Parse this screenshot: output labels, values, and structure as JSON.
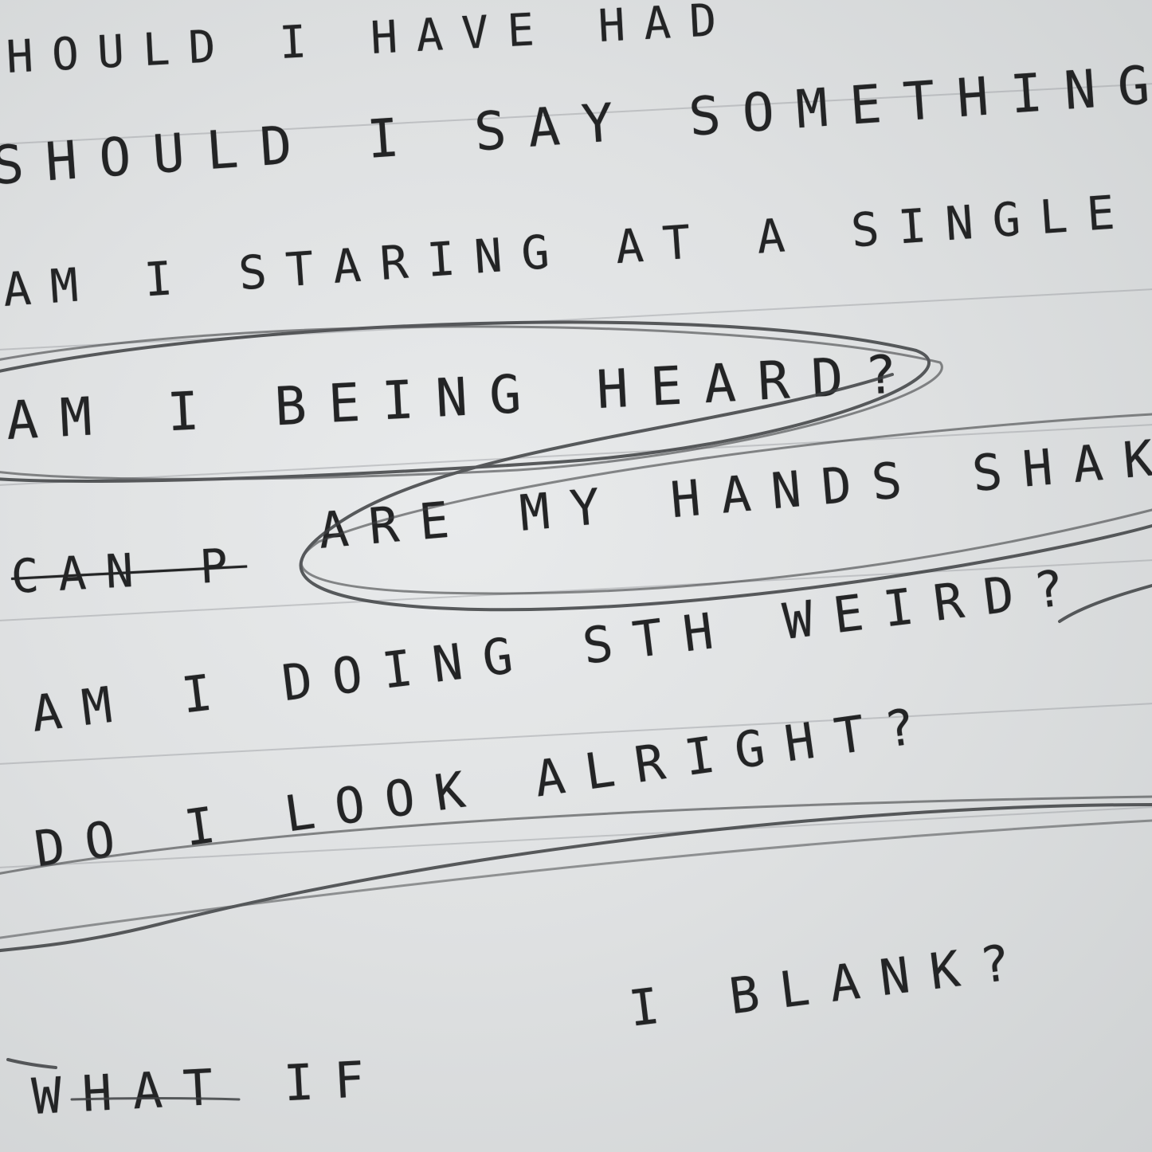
{
  "note": {
    "lines": [
      {
        "text": "HOULD I HAVE HAD"
      },
      {
        "text": "SHOULD I SAY SOMETHING FU"
      },
      {
        "text": "AM I STARING AT A SINGLE PERS"
      },
      {
        "text": "AM I BEING HEARD?"
      },
      {
        "text": "CAN P"
      },
      {
        "text": "ARE MY HANDS SHAKING"
      },
      {
        "text": "AM I DOING STH WEIRD?"
      },
      {
        "text": "DO I LOOK ALRIGHT?"
      },
      {
        "text": "I BLANK?"
      },
      {
        "text": "WHAT IF"
      }
    ]
  }
}
